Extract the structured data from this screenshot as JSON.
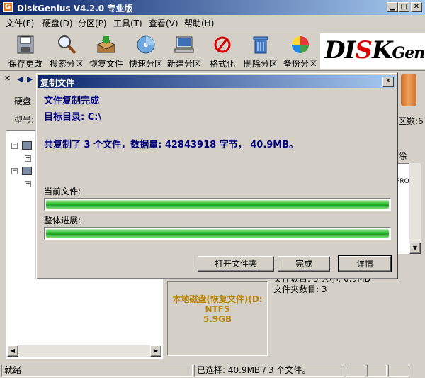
{
  "window": {
    "title": "DiskGenius V4.2.0 专业版",
    "app_icon_letter": "G"
  },
  "menu": [
    "文件(F)",
    "硬盘(D)",
    "分区(P)",
    "工具(T)",
    "查看(V)",
    "帮助(H)"
  ],
  "toolbar": [
    {
      "label": "保存更改",
      "icon": "save-icon"
    },
    {
      "label": "搜索分区",
      "icon": "magnifier-icon"
    },
    {
      "label": "恢复文件",
      "icon": "restore-box-icon"
    },
    {
      "label": "快速分区",
      "icon": "disc-icon"
    },
    {
      "label": "新建分区",
      "icon": "computer-icon"
    },
    {
      "label": "格式化",
      "icon": "format-icon"
    },
    {
      "label": "删除分区",
      "icon": "trash-icon"
    },
    {
      "label": "备份分区",
      "icon": "backup-pie-icon"
    }
  ],
  "logo": {
    "part1": "DI",
    "part2": "K",
    "part3": "Geniu"
  },
  "left_pane": {
    "disk_label": "硬盘",
    "model_label": "型号:"
  },
  "right_edge": {
    "sector_count": "区数:6",
    "delete_label": "除",
    "pro_text": "PRO"
  },
  "partition_box": {
    "name": "本地磁盘(恢复文件)(D:",
    "fs": "NTFS",
    "size": "5.9GB"
  },
  "info_text": {
    "line1": "文件数目: 3  大小: 0.9MB",
    "line2": "文件夹数目: 3"
  },
  "status": {
    "left": "就绪",
    "selection": "已选择: 40.9MB / 3 个文件。"
  },
  "dialog": {
    "title": "复制文件",
    "heading": "文件复制完成",
    "target": "目标目录: C:\\",
    "summary": "共复制了 3 个文件，数据量: 42843918 字节， 40.9MB。",
    "current_label": "当前文件:",
    "overall_label": "整体进展:",
    "current_progress": 1.0,
    "overall_progress": 1.0,
    "buttons": {
      "open_folder": "打开文件夹",
      "finish": "完成",
      "details": "详情"
    }
  },
  "colors": {
    "title_start": "#0a246a",
    "title_end": "#a6caf0",
    "progress": "#33c233",
    "partition_text": "#b8860b"
  }
}
